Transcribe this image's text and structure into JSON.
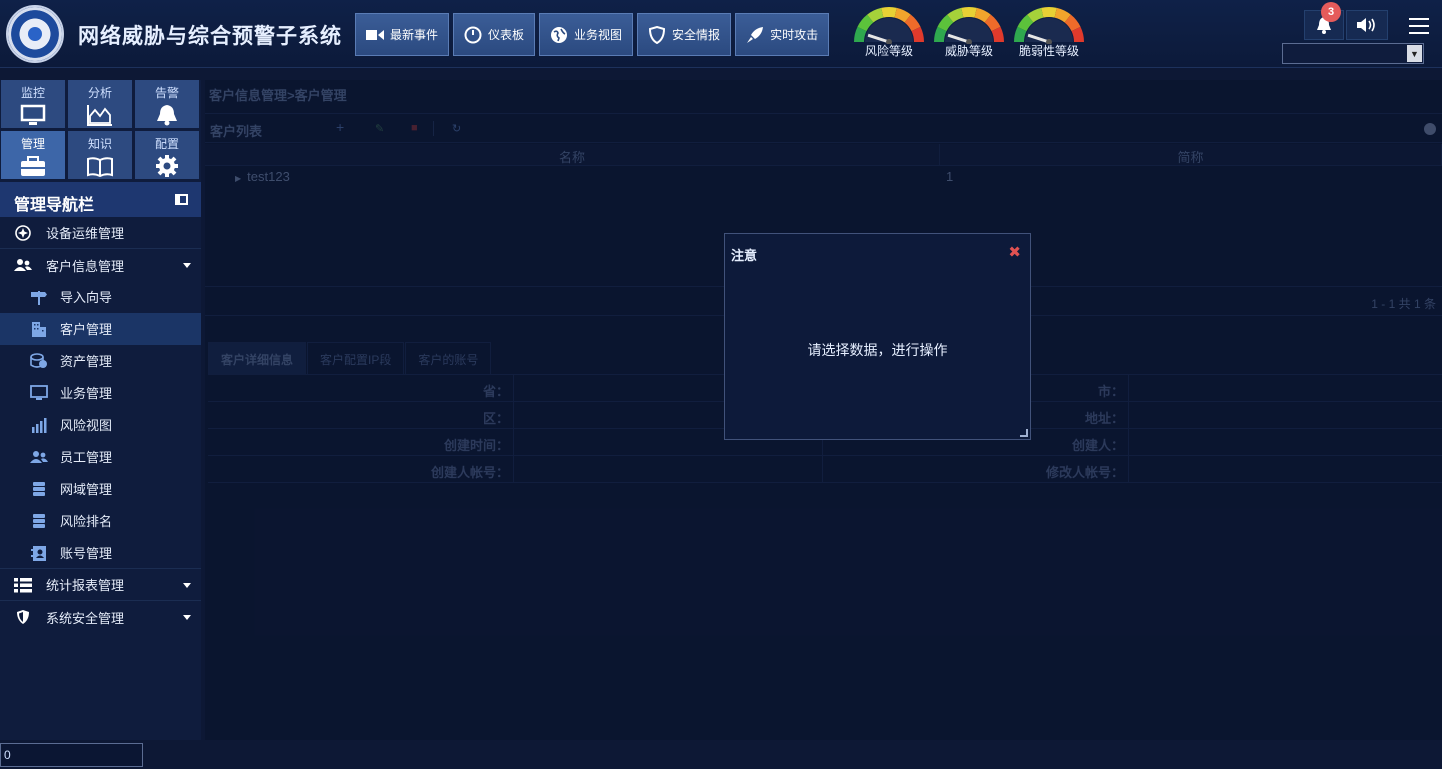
{
  "app": {
    "title": "网络威胁与综合预警子系统"
  },
  "nav_buttons": [
    {
      "label": "最新事件",
      "icon": "video-camera-icon"
    },
    {
      "label": "仪表板",
      "icon": "dashboard-icon"
    },
    {
      "label": "业务视图",
      "icon": "globe-icon"
    },
    {
      "label": "安全情报",
      "icon": "shield-icon"
    },
    {
      "label": "实时攻击",
      "icon": "rocket-icon"
    }
  ],
  "gauges": [
    {
      "label": "风险等级",
      "level": 0.1
    },
    {
      "label": "威胁等级",
      "level": 0.1
    },
    {
      "label": "脆弱性等级",
      "level": 0.1
    }
  ],
  "notifications": {
    "count": "3"
  },
  "top_select": {
    "value": ""
  },
  "modules": [
    {
      "label": "监控",
      "icon": "monitor-icon"
    },
    {
      "label": "分析",
      "icon": "area-chart-icon"
    },
    {
      "label": "告警",
      "icon": "bell-icon"
    },
    {
      "label": "管理",
      "icon": "briefcase-icon"
    },
    {
      "label": "知识",
      "icon": "book-icon"
    },
    {
      "label": "配置",
      "icon": "gear-icon"
    }
  ],
  "sidebar": {
    "header": "管理导航栏",
    "groups": [
      {
        "label": "设备运维管理"
      },
      {
        "label": "客户信息管理"
      },
      {
        "label": "统计报表管理"
      },
      {
        "label": "系统安全管理"
      }
    ],
    "sub_items": [
      {
        "label": "导入向导"
      },
      {
        "label": "客户管理"
      },
      {
        "label": "资产管理"
      },
      {
        "label": "业务管理"
      },
      {
        "label": "风险视图"
      },
      {
        "label": "员工管理"
      },
      {
        "label": "网域管理"
      },
      {
        "label": "风险排名"
      },
      {
        "label": "账号管理"
      }
    ]
  },
  "bottom_input": {
    "value": "0"
  },
  "main": {
    "breadcrumb": "客户信息管理>客户管理",
    "panel_title": "客户列表",
    "grid": {
      "columns": [
        "名称",
        "简称"
      ],
      "rows": [
        {
          "name": "test123",
          "short": "1"
        }
      ]
    },
    "pager": "1 - 1    共 1 条",
    "tabs": [
      "客户详细信息",
      "客户配置IP段",
      "客户的账号"
    ],
    "detail_labels": {
      "province": "省：",
      "city": "市：",
      "district": "区：",
      "address": "地址：",
      "created_time": "创建时间：",
      "creator": "创建人：",
      "creator_account": "创建人帐号：",
      "modifier_account": "修改人帐号："
    }
  },
  "dialog": {
    "title": "注意",
    "message": "请选择数据，进行操作"
  },
  "colors": {
    "accent": "#2d4a80",
    "close": "#e05252",
    "badge": "#e55b5b"
  }
}
